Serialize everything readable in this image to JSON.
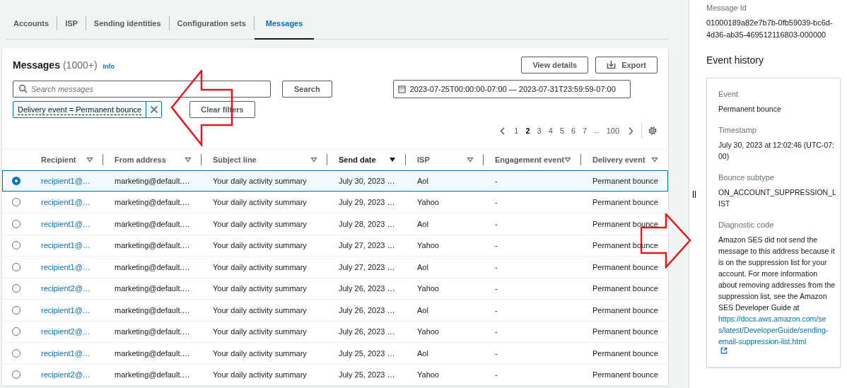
{
  "tabs": [
    {
      "label": "Accounts",
      "selected": false
    },
    {
      "label": "ISP",
      "selected": false
    },
    {
      "label": "Sending identities",
      "selected": false
    },
    {
      "label": "Configuration sets",
      "selected": false
    },
    {
      "label": "Messages",
      "selected": true
    }
  ],
  "messages": {
    "title": "Messages",
    "count": "(1000+)",
    "info": "Info",
    "buttons": [
      {
        "label": "View details",
        "kind": "plain"
      },
      {
        "label": "Export",
        "kind": "export"
      }
    ],
    "search": {
      "placeholder": "Search messages",
      "button": "Search"
    },
    "date_range": "2023-07-25T00:00:00-07:00 — 2023-07-31T23:59:59-07:00",
    "filter": {
      "label": "Delivery event = Permanent bounce"
    },
    "clear_filters": "Clear filters",
    "pages": [
      {
        "label": "1",
        "kind": "page",
        "selected": false
      },
      {
        "label": "2",
        "kind": "page",
        "selected": true
      },
      {
        "label": "3",
        "kind": "page",
        "selected": false
      },
      {
        "label": "4",
        "kind": "page",
        "selected": false
      },
      {
        "label": "5",
        "kind": "page",
        "selected": false
      },
      {
        "label": "6",
        "kind": "page",
        "selected": false
      },
      {
        "label": "7",
        "kind": "page",
        "selected": false
      },
      {
        "label": "...",
        "kind": "ellipsis"
      },
      {
        "label": "100",
        "kind": "page",
        "selected": false
      }
    ],
    "columns": [
      {
        "label": "Recipient",
        "sorted": false
      },
      {
        "label": "From address",
        "sorted": false
      },
      {
        "label": "Subject line",
        "sorted": false
      },
      {
        "label": "Send date",
        "sorted": true
      },
      {
        "label": "ISP",
        "sorted": false
      },
      {
        "label": "Engagement event",
        "sorted": false
      },
      {
        "label": "Delivery event",
        "sorted": false
      }
    ],
    "rows": [
      {
        "selected": true,
        "cells": [
          "recipient1@…",
          "marketing@default.…",
          "Your daily activity summary",
          "July 30, 2023 …",
          "Aol",
          "-",
          "Permanent bounce"
        ]
      },
      {
        "selected": false,
        "cells": [
          "recipient1@…",
          "marketing@default.…",
          "Your daily activity summary",
          "July 29, 2023 …",
          "Yahoo",
          "-",
          "Permanent bounce"
        ]
      },
      {
        "selected": false,
        "cells": [
          "recipient1@…",
          "marketing@default.…",
          "Your daily activity summary",
          "July 28, 2023 …",
          "Aol",
          "-",
          "Permanent bounce"
        ]
      },
      {
        "selected": false,
        "cells": [
          "recipient1@…",
          "marketing@default.…",
          "Your daily activity summary",
          "July 27, 2023 …",
          "Yahoo",
          "-",
          "Permanent bounce"
        ]
      },
      {
        "selected": false,
        "cells": [
          "recipient1@…",
          "marketing@default.…",
          "Your daily activity summary",
          "July 27, 2023 …",
          "Aol",
          "-",
          "Permanent bounce"
        ]
      },
      {
        "selected": false,
        "cells": [
          "recipient2@…",
          "marketing@default.…",
          "Your daily activity summary",
          "July 26, 2023 …",
          "Yahoo",
          "-",
          "Permanent bounce"
        ]
      },
      {
        "selected": false,
        "cells": [
          "recipient1@…",
          "marketing@default.…",
          "Your daily activity summary",
          "July 26, 2023 …",
          "Aol",
          "-",
          "Permanent bounce"
        ]
      },
      {
        "selected": false,
        "cells": [
          "recipient2@…",
          "marketing@default.…",
          "Your daily activity summary",
          "July 26, 2023 …",
          "Yahoo",
          "-",
          "Permanent bounce"
        ]
      },
      {
        "selected": false,
        "cells": [
          "recipient1@…",
          "marketing@default.…",
          "Your daily activity summary",
          "July 25, 2023 …",
          "Aol",
          "-",
          "Permanent bounce"
        ]
      },
      {
        "selected": false,
        "cells": [
          "recipient2@…",
          "marketing@default.…",
          "Your daily activity summary",
          "July 25, 2023 …",
          "Yahoo",
          "-",
          "Permanent bounce"
        ]
      }
    ]
  },
  "details": {
    "id_label": "Message Id",
    "id_value": "01000189a82e7b7b-0fb59039-bc6d-4d36-ab35-469512116803-000000",
    "heading": "Event history",
    "fields": [
      {
        "label": "Event",
        "value": "Permanent bounce"
      },
      {
        "label": "Timestamp",
        "value": "July 30, 2023 at 12:02:46 (UTC-07:00)"
      },
      {
        "label": "Bounce subtype",
        "value": "ON_ACCOUNT_SUPPRESSION_LIST"
      },
      {
        "label": "Diagnostic code",
        "value": "Amazon SES did not send the message to this address because it is on the suppression list for your account. For more information about removing addresses from the suppression list, see the Amazon SES Developer Guide at",
        "link": "https://docs.aws.amazon.com/ses/latest/DeveloperGuide/sending-email-suppression-list.html"
      }
    ]
  }
}
